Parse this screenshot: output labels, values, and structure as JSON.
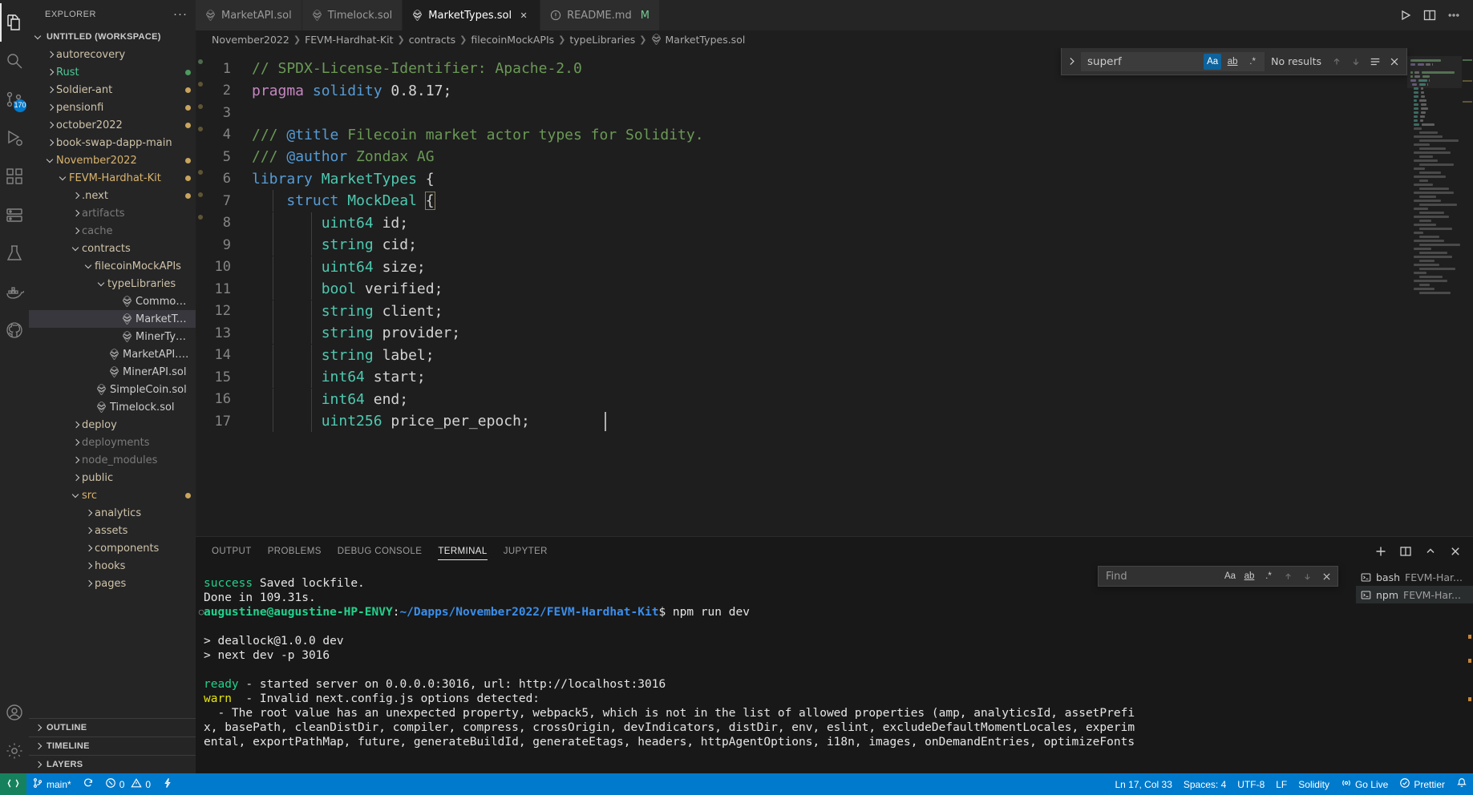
{
  "activitybar": {
    "items": [
      {
        "name": "explorer-icon",
        "label": "Explorer",
        "active": true,
        "badge": ""
      },
      {
        "name": "search-icon",
        "label": "Search",
        "active": false,
        "badge": ""
      },
      {
        "name": "source-control-icon",
        "label": "Source Control",
        "active": false,
        "badge": "170"
      },
      {
        "name": "run-debug-icon",
        "label": "Run and Debug",
        "active": false,
        "badge": ""
      },
      {
        "name": "extensions-icon",
        "label": "Extensions",
        "active": false,
        "badge": ""
      },
      {
        "name": "remote-explorer-icon",
        "label": "Remote Explorer",
        "active": false,
        "badge": ""
      },
      {
        "name": "testing-icon",
        "label": "Testing",
        "active": false,
        "badge": ""
      },
      {
        "name": "docker-icon",
        "label": "Docker",
        "active": false,
        "badge": ""
      },
      {
        "name": "github-icon",
        "label": "GitHub",
        "active": false,
        "badge": ""
      }
    ],
    "bottom": [
      {
        "name": "accounts-icon",
        "label": "Accounts"
      },
      {
        "name": "settings-gear-icon",
        "label": "Manage"
      }
    ]
  },
  "sidebar": {
    "title": "EXPLORER",
    "more_actions": "···",
    "workspace": "UNTITLED (WORKSPACE)",
    "tree": [
      {
        "label": "autorecovery",
        "indent": 1,
        "type": "folder",
        "open": false,
        "color": "#cfc3a8",
        "dot": ""
      },
      {
        "label": "Rust",
        "indent": 1,
        "type": "folder",
        "open": false,
        "color": "#4ec994",
        "dot": "#4e9a5f"
      },
      {
        "label": "Soldier-ant",
        "indent": 1,
        "type": "folder",
        "open": false,
        "color": "#cfc3a8",
        "dot": "#c8a45c"
      },
      {
        "label": "pensionfi",
        "indent": 1,
        "type": "folder",
        "open": false,
        "color": "#cfc3a8",
        "dot": "#c8a45c"
      },
      {
        "label": "october2022",
        "indent": 1,
        "type": "folder",
        "open": false,
        "color": "#cfc3a8",
        "dot": "#c8a45c"
      },
      {
        "label": "book-swap-dapp-main",
        "indent": 1,
        "type": "folder",
        "open": false,
        "color": "#cfc3a8",
        "dot": ""
      },
      {
        "label": "November2022",
        "indent": 1,
        "type": "folder",
        "open": true,
        "color": "#d9b36c",
        "dot": "#c8a45c"
      },
      {
        "label": "FEVM-Hardhat-Kit",
        "indent": 2,
        "type": "folder",
        "open": true,
        "color": "#d9b36c",
        "dot": "#c8a45c"
      },
      {
        "label": ".next",
        "indent": 3,
        "type": "folder",
        "open": false,
        "color": "#cfc3a8",
        "dot": "#c8a45c"
      },
      {
        "label": "artifacts",
        "indent": 3,
        "type": "folder",
        "open": false,
        "color": "#7a7a7a",
        "dot": ""
      },
      {
        "label": "cache",
        "indent": 3,
        "type": "folder",
        "open": false,
        "color": "#7a7a7a",
        "dot": ""
      },
      {
        "label": "contracts",
        "indent": 3,
        "type": "folder",
        "open": true,
        "color": "#cfc3a8",
        "dot": ""
      },
      {
        "label": "filecoinMockAPIs",
        "indent": 4,
        "type": "folder",
        "open": true,
        "color": "#cfc3a8",
        "dot": ""
      },
      {
        "label": "typeLibraries",
        "indent": 5,
        "type": "folder",
        "open": true,
        "color": "#cfc3a8",
        "dot": ""
      },
      {
        "label": "CommonTypes.sol",
        "indent": 6,
        "type": "sol",
        "open": false,
        "color": "#cccccc",
        "dot": ""
      },
      {
        "label": "MarketTypes.sol",
        "indent": 6,
        "type": "sol",
        "open": false,
        "color": "#cccccc",
        "dot": "",
        "selected": true
      },
      {
        "label": "MinerTypes.sol",
        "indent": 6,
        "type": "sol",
        "open": false,
        "color": "#cccccc",
        "dot": ""
      },
      {
        "label": "MarketAPI.sol",
        "indent": 5,
        "type": "sol",
        "open": false,
        "color": "#cccccc",
        "dot": ""
      },
      {
        "label": "MinerAPI.sol",
        "indent": 5,
        "type": "sol",
        "open": false,
        "color": "#cccccc",
        "dot": ""
      },
      {
        "label": "SimpleCoin.sol",
        "indent": 4,
        "type": "sol",
        "open": false,
        "color": "#cccccc",
        "dot": ""
      },
      {
        "label": "Timelock.sol",
        "indent": 4,
        "type": "sol",
        "open": false,
        "color": "#cccccc",
        "dot": ""
      },
      {
        "label": "deploy",
        "indent": 3,
        "type": "folder",
        "open": false,
        "color": "#cfc3a8",
        "dot": ""
      },
      {
        "label": "deployments",
        "indent": 3,
        "type": "folder",
        "open": false,
        "color": "#7a7a7a",
        "dot": ""
      },
      {
        "label": "node_modules",
        "indent": 3,
        "type": "folder",
        "open": false,
        "color": "#7a7a7a",
        "dot": ""
      },
      {
        "label": "public",
        "indent": 3,
        "type": "folder",
        "open": false,
        "color": "#cfc3a8",
        "dot": ""
      },
      {
        "label": "src",
        "indent": 3,
        "type": "folder",
        "open": true,
        "color": "#d9b36c",
        "dot": "#c8a45c"
      },
      {
        "label": "analytics",
        "indent": 4,
        "type": "folder",
        "open": false,
        "color": "#cfc3a8",
        "dot": ""
      },
      {
        "label": "assets",
        "indent": 4,
        "type": "folder",
        "open": false,
        "color": "#cfc3a8",
        "dot": ""
      },
      {
        "label": "components",
        "indent": 4,
        "type": "folder",
        "open": false,
        "color": "#cfc3a8",
        "dot": ""
      },
      {
        "label": "hooks",
        "indent": 4,
        "type": "folder",
        "open": false,
        "color": "#cfc3a8",
        "dot": ""
      },
      {
        "label": "pages",
        "indent": 4,
        "type": "folder",
        "open": false,
        "color": "#cfc3a8",
        "dot": ""
      }
    ],
    "bottom_sections": [
      "OUTLINE",
      "TIMELINE",
      "LAYERS"
    ]
  },
  "tabs": [
    {
      "label": "MarketAPI.sol",
      "icon": "solidity-icon",
      "active": false,
      "closable": false,
      "modified": false
    },
    {
      "label": "Timelock.sol",
      "icon": "solidity-icon",
      "active": false,
      "closable": false,
      "modified": false
    },
    {
      "label": "MarketTypes.sol",
      "icon": "solidity-icon",
      "active": true,
      "closable": true,
      "modified": false
    },
    {
      "label": "README.md",
      "icon": "markdown-icon",
      "active": false,
      "closable": false,
      "modified": true,
      "suffix": "M"
    }
  ],
  "tab_actions": [
    {
      "name": "run-code-icon",
      "label": "Run Code"
    },
    {
      "name": "split-editor-icon",
      "label": "Split Editor Right"
    },
    {
      "name": "more-actions-icon",
      "label": "More Actions..."
    }
  ],
  "breadcrumb": [
    "November2022",
    "FEVM-Hardhat-Kit",
    "contracts",
    "filecoinMockAPIs",
    "typeLibraries",
    "MarketTypes.sol"
  ],
  "find_widget": {
    "query": "superf",
    "placeholder": "Find",
    "match_count": "No results",
    "match_case": "Aa",
    "whole_word": "ab",
    "regex": ".*",
    "match_case_on": true,
    "whole_word_on": false,
    "regex_on": false,
    "prev_label": "Previous Match",
    "next_label": "Next Match",
    "selection_label": "Find in Selection",
    "close_label": "Close"
  },
  "editor": {
    "language": "Solidity",
    "lines": [
      {
        "n": 1,
        "tokens": [
          {
            "t": "// SPDX-License-Identifier: Apache-2.0",
            "c": "tk-comment"
          }
        ]
      },
      {
        "n": 2,
        "tokens": [
          {
            "t": "pragma",
            "c": "tk-kw"
          },
          {
            "t": " ",
            "c": "tk-plain"
          },
          {
            "t": "solidity",
            "c": "tk-kw2"
          },
          {
            "t": " ",
            "c": "tk-plain"
          },
          {
            "t": "0.8.17",
            "c": "tk-num"
          },
          {
            "t": ";",
            "c": "tk-plain"
          }
        ]
      },
      {
        "n": 3,
        "tokens": []
      },
      {
        "n": 4,
        "tokens": [
          {
            "t": "/// ",
            "c": "tk-comment"
          },
          {
            "t": "@title",
            "c": "tk-doc-tag"
          },
          {
            "t": " Filecoin market actor types for Solidity.",
            "c": "tk-comment"
          }
        ]
      },
      {
        "n": 5,
        "tokens": [
          {
            "t": "/// ",
            "c": "tk-comment"
          },
          {
            "t": "@author",
            "c": "tk-doc-tag"
          },
          {
            "t": " Zondax AG",
            "c": "tk-comment"
          }
        ]
      },
      {
        "n": 6,
        "tokens": [
          {
            "t": "library",
            "c": "tk-kw2"
          },
          {
            "t": " ",
            "c": "tk-plain"
          },
          {
            "t": "MarketTypes",
            "c": "tk-type"
          },
          {
            "t": " {",
            "c": "tk-plain"
          }
        ]
      },
      {
        "n": 7,
        "tokens": [
          {
            "t": "    ",
            "c": "tk-plain"
          },
          {
            "t": "struct",
            "c": "tk-kw2"
          },
          {
            "t": " ",
            "c": "tk-plain"
          },
          {
            "t": "MockDeal",
            "c": "tk-type"
          },
          {
            "t": " ",
            "c": "tk-plain"
          },
          {
            "t": "{",
            "c": "tk-brace-hl"
          }
        ]
      },
      {
        "n": 8,
        "tokens": [
          {
            "t": "        ",
            "c": "tk-plain"
          },
          {
            "t": "uint64",
            "c": "tk-type"
          },
          {
            "t": " id;",
            "c": "tk-plain"
          }
        ]
      },
      {
        "n": 9,
        "tokens": [
          {
            "t": "        ",
            "c": "tk-plain"
          },
          {
            "t": "string",
            "c": "tk-type"
          },
          {
            "t": " cid;",
            "c": "tk-plain"
          }
        ]
      },
      {
        "n": 10,
        "tokens": [
          {
            "t": "        ",
            "c": "tk-plain"
          },
          {
            "t": "uint64",
            "c": "tk-type"
          },
          {
            "t": " size;",
            "c": "tk-plain"
          }
        ]
      },
      {
        "n": 11,
        "tokens": [
          {
            "t": "        ",
            "c": "tk-plain"
          },
          {
            "t": "bool",
            "c": "tk-type"
          },
          {
            "t": " verified;",
            "c": "tk-plain"
          }
        ]
      },
      {
        "n": 12,
        "tokens": [
          {
            "t": "        ",
            "c": "tk-plain"
          },
          {
            "t": "string",
            "c": "tk-type"
          },
          {
            "t": " client;",
            "c": "tk-plain"
          }
        ]
      },
      {
        "n": 13,
        "tokens": [
          {
            "t": "        ",
            "c": "tk-plain"
          },
          {
            "t": "string",
            "c": "tk-type"
          },
          {
            "t": " provider;",
            "c": "tk-plain"
          }
        ]
      },
      {
        "n": 14,
        "tokens": [
          {
            "t": "        ",
            "c": "tk-plain"
          },
          {
            "t": "string",
            "c": "tk-type"
          },
          {
            "t": " label;",
            "c": "tk-plain"
          }
        ]
      },
      {
        "n": 15,
        "tokens": [
          {
            "t": "        ",
            "c": "tk-plain"
          },
          {
            "t": "int64",
            "c": "tk-type"
          },
          {
            "t": " start;",
            "c": "tk-plain"
          }
        ]
      },
      {
        "n": 16,
        "tokens": [
          {
            "t": "        ",
            "c": "tk-plain"
          },
          {
            "t": "int64",
            "c": "tk-type"
          },
          {
            "t": " end;",
            "c": "tk-plain"
          }
        ]
      },
      {
        "n": 17,
        "tokens": [
          {
            "t": "        ",
            "c": "tk-plain"
          },
          {
            "t": "uint256",
            "c": "tk-type"
          },
          {
            "t": " price_per_epoch;",
            "c": "tk-plain"
          }
        ]
      }
    ]
  },
  "panel": {
    "tabs": [
      {
        "label": "OUTPUT",
        "active": false
      },
      {
        "label": "PROBLEMS",
        "active": false
      },
      {
        "label": "DEBUG CONSOLE",
        "active": false
      },
      {
        "label": "TERMINAL",
        "active": true
      },
      {
        "label": "JUPYTER",
        "active": false
      }
    ],
    "actions": [
      {
        "name": "new-terminal-icon",
        "label": "New Terminal"
      },
      {
        "name": "split-terminal-icon",
        "label": "Split Terminal"
      },
      {
        "name": "panel-maximize-icon",
        "label": "Maximize Panel Size"
      },
      {
        "name": "panel-close-icon",
        "label": "Close Panel"
      }
    ],
    "find": {
      "placeholder": "Find",
      "value": "",
      "match_case": "Aa",
      "whole_word": "ab",
      "regex": ".*"
    },
    "terminal_list": [
      {
        "icon": "bash-icon",
        "name": "bash",
        "sub": "FEVM-Har...",
        "active": false
      },
      {
        "icon": "npm-icon",
        "name": "npm",
        "sub": "FEVM-Har...",
        "active": true
      }
    ],
    "terminal_lines": [
      {
        "parts": [
          {
            "t": "success",
            "c": "t-green"
          },
          {
            "t": " Saved lockfile.",
            "c": "t-white"
          }
        ]
      },
      {
        "parts": [
          {
            "t": "Done in 109.31s.",
            "c": "t-white"
          }
        ]
      },
      {
        "parts": [
          {
            "t": "augustine@augustine-HP-ENVY",
            "c": "t-green-b"
          },
          {
            "t": ":",
            "c": "t-white"
          },
          {
            "t": "~/Dapps/November2022/FEVM-Hardhat-Kit",
            "c": "t-blue-b"
          },
          {
            "t": "$ npm run dev",
            "c": "t-white"
          }
        ],
        "deco": "circle"
      },
      {
        "parts": []
      },
      {
        "parts": [
          {
            "t": "> deallock@1.0.0 dev",
            "c": "t-white"
          }
        ]
      },
      {
        "parts": [
          {
            "t": "> next dev -p 3016",
            "c": "t-white"
          }
        ]
      },
      {
        "parts": []
      },
      {
        "parts": [
          {
            "t": "ready",
            "c": "t-green"
          },
          {
            "t": " - started server on 0.0.0.0:3016, url: http://localhost:3016",
            "c": "t-white"
          }
        ]
      },
      {
        "parts": [
          {
            "t": "warn",
            "c": "t-yellow"
          },
          {
            "t": "  - Invalid next.config.js options detected:",
            "c": "t-white"
          }
        ]
      },
      {
        "parts": [
          {
            "t": "  - The root value has an unexpected property, webpack5, which is not in the list of allowed properties (amp, analyticsId, assetPrefi",
            "c": "t-white"
          }
        ]
      },
      {
        "parts": [
          {
            "t": "x, basePath, cleanDistDir, compiler, compress, crossOrigin, devIndicators, distDir, env, eslint, excludeDefaultMomentLocales, experim",
            "c": "t-white"
          }
        ]
      },
      {
        "parts": [
          {
            "t": "ental, exportPathMap, future, generateBuildId, generateEtags, headers, httpAgentOptions, i18n, images, onDemandEntries, optimizeFonts",
            "c": "t-white"
          }
        ]
      }
    ]
  },
  "statusbar": {
    "left": [
      {
        "name": "remote-indicator",
        "icon": "remote-icon",
        "label": "",
        "remote": true
      },
      {
        "name": "branch-status",
        "icon": "source-control-icon",
        "label": "main*"
      },
      {
        "name": "sync-status",
        "icon": "sync-icon",
        "label": ""
      },
      {
        "name": "problems-status",
        "icon": "error-warning-icon",
        "label": "0  0"
      }
    ],
    "errors": "0",
    "warnings": "0",
    "branch": "main*",
    "ports_label": "",
    "right": [
      {
        "name": "editor-position",
        "label": "Ln 17, Col 33"
      },
      {
        "name": "editor-indentation",
        "label": "Spaces: 4"
      },
      {
        "name": "editor-encoding",
        "label": "UTF-8"
      },
      {
        "name": "editor-eol",
        "label": "LF"
      },
      {
        "name": "editor-language",
        "label": "Solidity"
      },
      {
        "name": "go-live",
        "label": "Go Live",
        "icon": "broadcast-icon"
      },
      {
        "name": "prettier-status",
        "label": "Prettier",
        "icon": "check-icon"
      },
      {
        "name": "notifications",
        "label": "",
        "icon": "bell-icon"
      }
    ]
  },
  "colors": {
    "accent": "#007acc",
    "remote_green": "#16825d",
    "sidebar_bg": "#252526",
    "editor_bg": "#1e1e1e",
    "panel_bg": "#181818",
    "selection": "#37373d"
  }
}
